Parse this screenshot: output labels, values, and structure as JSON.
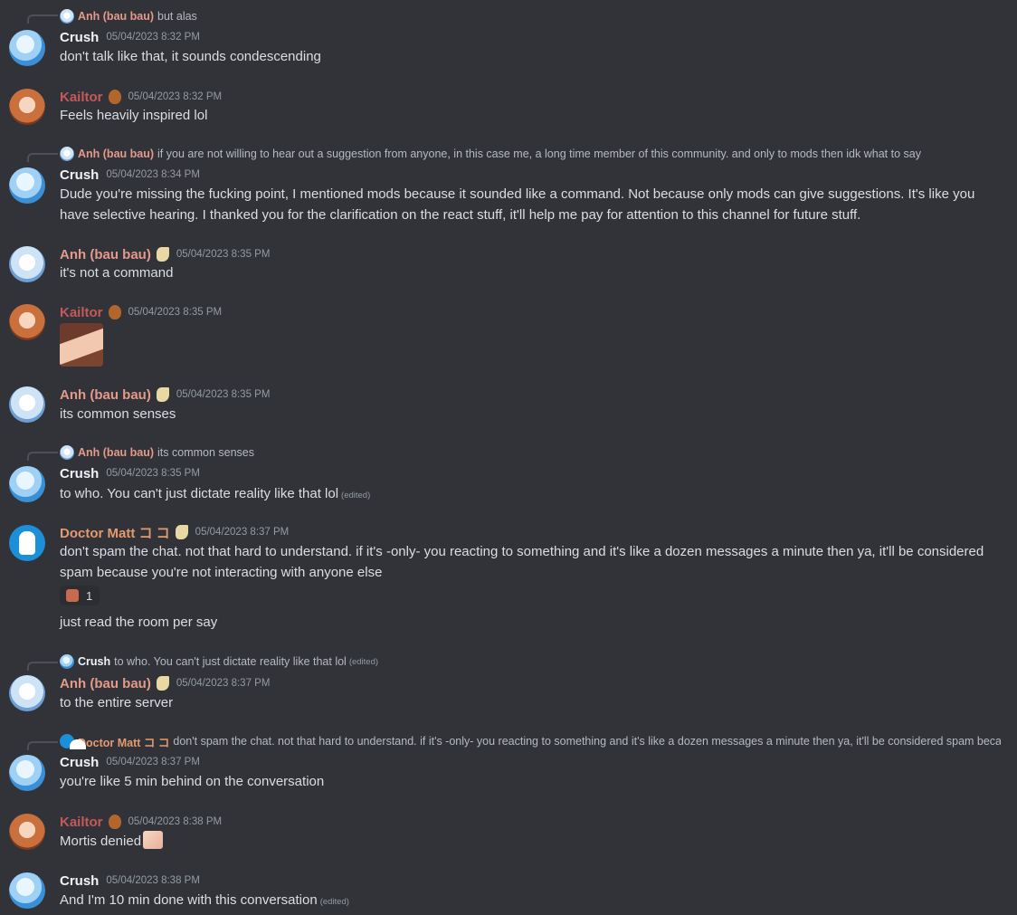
{
  "messages": [
    {
      "author": "Crush",
      "timestamp": "05/04/2023 8:32 PM",
      "reply": {
        "author": "Anh (bau bau)",
        "text": "but alas"
      },
      "text": "don't talk like that, it sounds condescending"
    },
    {
      "author": "Kailtor",
      "timestamp": "05/04/2023 8:32 PM",
      "text": "Feels heavily inspired lol"
    },
    {
      "author": "Crush",
      "timestamp": "05/04/2023 8:34 PM",
      "reply": {
        "author": "Anh (bau bau)",
        "text": "if you are not willing to hear out a suggestion from anyone, in this case me, a long time member of this community. and only to mods then idk what to say"
      },
      "text": "Dude you're missing the fucking point, I mentioned mods because it sounded like a command. Not because only mods can give suggestions. It's like you have selective hearing. I thanked you for the clarification on the react stuff, it'll help me pay for attention to this channel for future stuff."
    },
    {
      "author": "Anh (bau bau)",
      "timestamp": "05/04/2023 8:35 PM",
      "text": "it's not a command"
    },
    {
      "author": "Kailtor",
      "timestamp": "05/04/2023 8:35 PM",
      "sticker": "sticker-image"
    },
    {
      "author": "Anh (bau bau)",
      "timestamp": "05/04/2023 8:35 PM",
      "text": "its common senses"
    },
    {
      "author": "Crush",
      "timestamp": "05/04/2023 8:35 PM",
      "reply": {
        "author": "Anh (bau bau)",
        "text": "its common senses"
      },
      "text": "to who. You can't just dictate reality like that lol",
      "edited": "(edited)"
    },
    {
      "author": "Doctor Matt コ コ",
      "timestamp": "05/04/2023 8:37 PM",
      "text": "don't spam the chat. not that hard to understand. if it's -only- you reacting to something and it's like a dozen messages a minute then ya, it'll be considered spam because you're not interacting with anyone else",
      "reaction_count": "1",
      "followup": "just read the room per say"
    },
    {
      "author": "Anh (bau bau)",
      "timestamp": "05/04/2023 8:37 PM",
      "reply": {
        "author": "Crush",
        "text": "to who. You can't just dictate reality like that lol",
        "edited": "(edited)"
      },
      "text": "to the entire server"
    },
    {
      "author": "Crush",
      "timestamp": "05/04/2023 8:37 PM",
      "reply": {
        "author": "Doctor Matt コ コ",
        "text": "don't spam the chat. not that hard to understand. if it's -only- you reacting to something and it's like a dozen messages a minute then ya, it'll be considered spam because you're not interacting with anyone else"
      },
      "text": "you're like 5 min behind on the conversation"
    },
    {
      "author": "Kailtor",
      "timestamp": "05/04/2023 8:38 PM",
      "text": "Mortis denied"
    },
    {
      "author": "Crush",
      "timestamp": "05/04/2023 8:38 PM",
      "text": "And I'm 10 min done with this conversation",
      "edited": "(edited)"
    }
  ],
  "colors": {
    "background": "#313338",
    "crush": "#f2f3f5",
    "kailtor": "#c35a5a",
    "anh": "#e39a8b",
    "doctor_matt": "#e39a6f"
  }
}
